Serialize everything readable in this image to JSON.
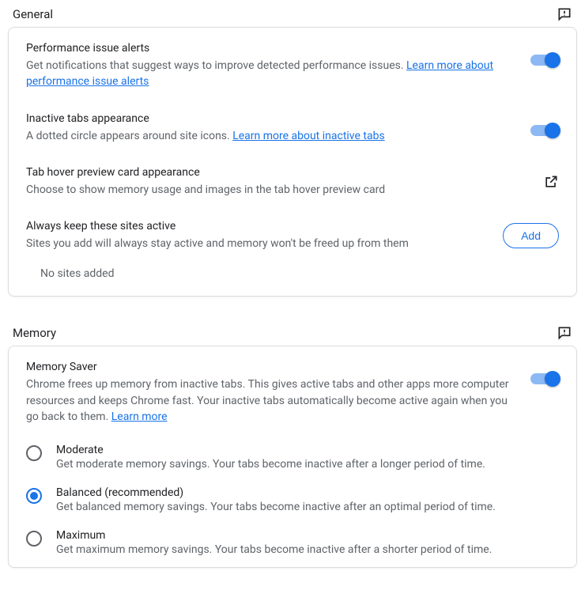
{
  "general": {
    "title": "General",
    "perf": {
      "title": "Performance issue alerts",
      "desc": "Get notifications that suggest ways to improve detected performance issues. ",
      "link": "Learn more about performance issue alerts"
    },
    "inactive": {
      "title": "Inactive tabs appearance",
      "desc": "A dotted circle appears around site icons. ",
      "link": "Learn more about inactive tabs"
    },
    "hover": {
      "title": "Tab hover preview card appearance",
      "desc": "Choose to show memory usage and images in the tab hover preview card"
    },
    "keep": {
      "title": "Always keep these sites active",
      "desc": "Sites you add will always stay active and memory won't be freed up from them",
      "button": "Add",
      "empty": "No sites added"
    }
  },
  "memory": {
    "title": "Memory",
    "saver": {
      "title": "Memory Saver",
      "desc": "Chrome frees up memory from inactive tabs. This gives active tabs and other apps more computer resources and keeps Chrome fast. Your inactive tabs automatically become active again when you go back to them. ",
      "link": "Learn more"
    },
    "options": [
      {
        "label": "Moderate",
        "desc": "Get moderate memory savings. Your tabs become inactive after a longer period of time.",
        "selected": false
      },
      {
        "label": "Balanced (recommended)",
        "desc": "Get balanced memory savings. Your tabs become inactive after an optimal period of time.",
        "selected": true
      },
      {
        "label": "Maximum",
        "desc": "Get maximum memory savings. Your tabs become inactive after a shorter period of time.",
        "selected": false
      }
    ]
  }
}
